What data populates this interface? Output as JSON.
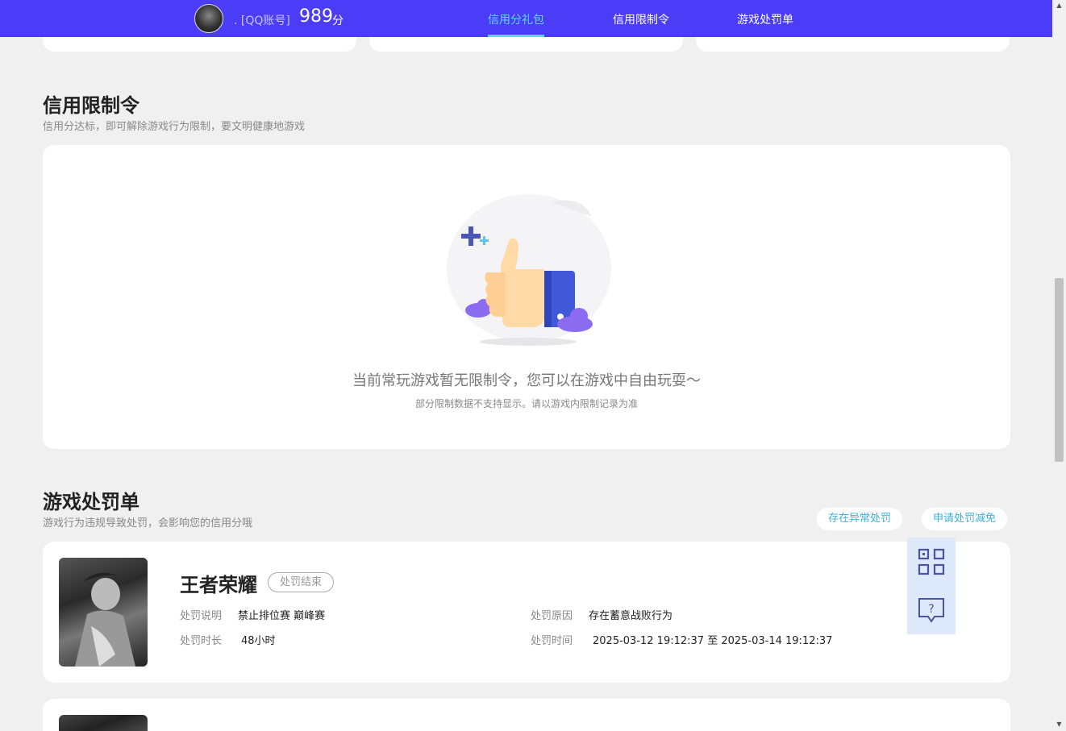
{
  "header": {
    "account_label": ". [QQ账号]",
    "score": "989",
    "score_unit": "分",
    "nav": [
      {
        "label": "信用分礼包",
        "active": true
      },
      {
        "label": "信用限制令",
        "active": false
      },
      {
        "label": "游戏处罚单",
        "active": false
      }
    ]
  },
  "restriction": {
    "title": "信用限制令",
    "subtitle": "信用分达标，即可解除游戏行为限制，要文明健康地游戏",
    "empty_main": "当前常玩游戏暂无限制令，您可以在游戏中自由玩耍～",
    "empty_sub": "部分限制数据不支持显示。请以游戏内限制记录为准"
  },
  "penalty": {
    "title": "游戏处罚单",
    "subtitle": "游戏行为违规导致处罚，会影响您的信用分哦",
    "btn_abnormal": "存在异常处罚",
    "btn_appeal": "申请处罚减免",
    "items": [
      {
        "game": "王者荣耀",
        "status": "处罚结束",
        "desc_label": "处罚说明",
        "desc_value": "禁止排位赛 巅峰赛",
        "reason_label": "处罚原因",
        "reason_value": "存在蓄意战败行为",
        "duration_label": "处罚时长",
        "duration_value": "48小时",
        "time_label": "处罚时间",
        "time_value": "2025-03-12 19:12:37 至 2025-03-14 19:12:37"
      }
    ]
  },
  "side_tools": {
    "qr_icon": "qr-code-icon",
    "help_icon": "help-chat-icon"
  },
  "colors": {
    "header_bg": "#4a3cf7",
    "nav_active": "#5fd6ff",
    "pill_text": "#3ab0e0"
  }
}
